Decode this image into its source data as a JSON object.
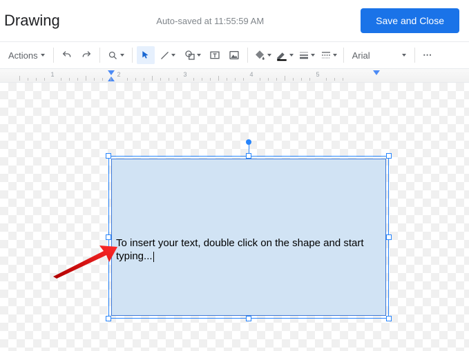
{
  "header": {
    "title": "Drawing",
    "autosave": "Auto-saved at 11:55:59 AM",
    "save_button": "Save and Close"
  },
  "toolbar": {
    "actions": "Actions",
    "font": "Arial",
    "icons": {
      "undo": "undo-icon",
      "redo": "redo-icon",
      "zoom": "zoom-icon",
      "select": "select-icon",
      "line": "line-icon",
      "shape": "shape-icon",
      "textbox": "textbox-icon",
      "image": "image-icon",
      "fill": "fill-icon",
      "border_color": "border-color-icon",
      "border_weight": "border-weight-icon",
      "border_dash": "border-dash-icon",
      "more": "more-icon"
    }
  },
  "ruler": {
    "units": [
      1,
      2,
      3,
      4,
      5
    ]
  },
  "canvas": {
    "shape_text": "To insert your text, double click on the shape and start typing..."
  }
}
